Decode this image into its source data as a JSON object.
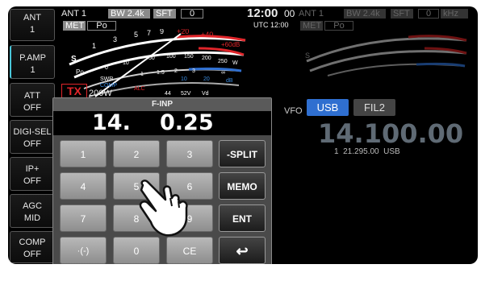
{
  "sidebar": [
    {
      "line1": "ANT",
      "line2": "1"
    },
    {
      "line1": "P.AMP",
      "line2": "1"
    },
    {
      "line1": "ATT",
      "line2": "OFF"
    },
    {
      "line1": "DIGI-SEL",
      "line2": "OFF"
    },
    {
      "line1": "IP+",
      "line2": "OFF"
    },
    {
      "line1": "AGC",
      "line2": "MID"
    },
    {
      "line1": "COMP",
      "line2": "OFF"
    }
  ],
  "top": {
    "ant_left": "ANT 1",
    "bw_left": "BW 2.4k",
    "sft_left": "SFT",
    "sft_left_value": "0",
    "clock": "12:00",
    "clock_seconds": "00",
    "utc": "UTC 12:00",
    "ant_right": "ANT 1",
    "bw_right": "BW 2.4k",
    "sft_right": "SFT",
    "sft_right_value": "0",
    "khz": "kHz"
  },
  "meter": {
    "met_label": "MET",
    "met_value": "Po",
    "s_label": "S",
    "po_label": "Po",
    "swr_label": "SWR",
    "comp_label": "COMP",
    "s_scale": [
      "1",
      "3",
      "5",
      "7",
      "9",
      "+20",
      "+40",
      "+60dB"
    ],
    "po_scale": [
      "0",
      "10",
      "50",
      "100",
      "150",
      "200",
      "250",
      "W"
    ],
    "swr_scale": [
      "1",
      "1.5",
      "2",
      "3",
      "∞"
    ],
    "comp_scale": [
      "10",
      "20",
      "dB"
    ],
    "vd_scale": [
      "44",
      "52V",
      "Vd"
    ],
    "alc_label": "ALC",
    "tx": "TX",
    "power": "200W"
  },
  "keypad": {
    "title": "F-INP",
    "freq_mhz": "14.",
    "freq_khz": "0.25",
    "keys": [
      [
        "1",
        "2",
        "3",
        "-SPLIT"
      ],
      [
        "4",
        "5",
        "6",
        "MEMO"
      ],
      [
        "7",
        "8",
        "9",
        "ENT"
      ],
      [
        "·(-)",
        "0",
        "CE",
        "↩"
      ]
    ]
  },
  "vfo": {
    "label": "VFO",
    "mode": "USB",
    "filter": "FIL2",
    "frequency": "14.100.00",
    "sub_info": "1  21.295.00  USB"
  },
  "colors": {
    "accent": "#2f6fd0",
    "red": "#e0252a",
    "tx": "#e0252a",
    "cyan": "#49c6d9"
  }
}
